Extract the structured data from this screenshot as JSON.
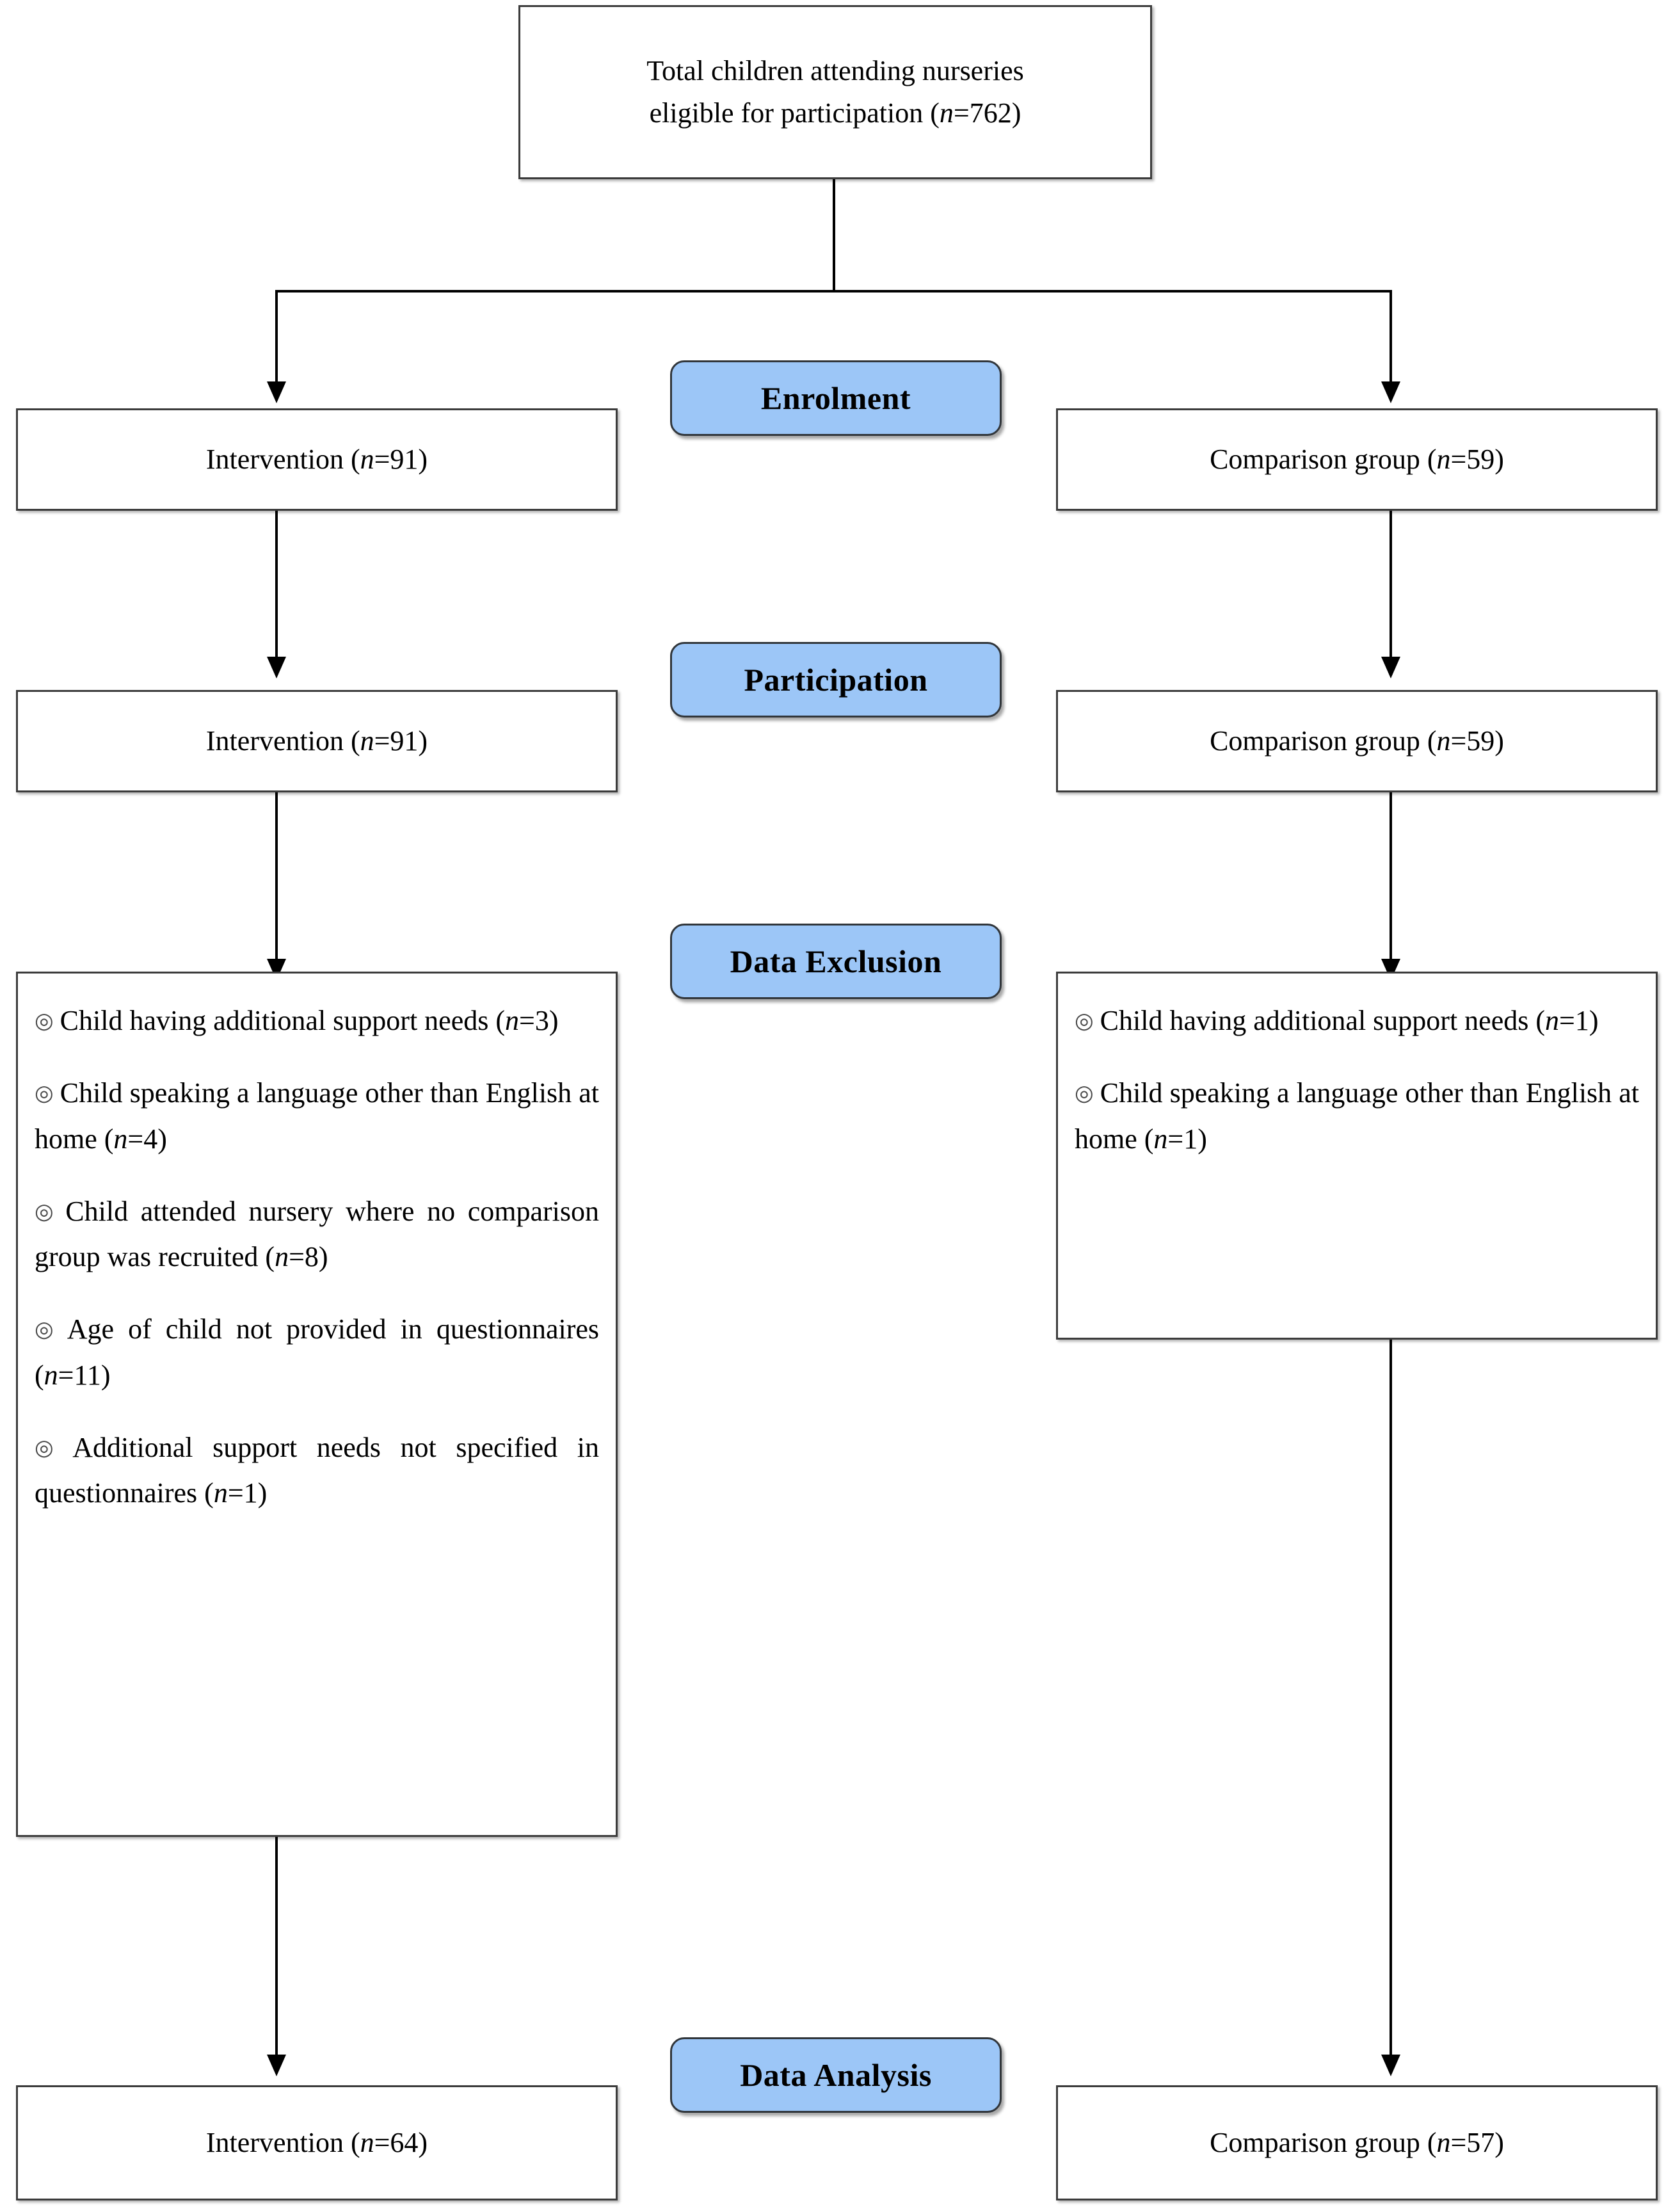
{
  "figure": {
    "type": "participant-flow-diagram",
    "accent_blue": "#9CC6F7",
    "border_color": "#3c3c3c"
  },
  "top_box": {
    "line1": "Total children attending nurseries",
    "line2_prefix": "eligible for participation (",
    "line2_italic": "n",
    "line2_suffix": "=762)"
  },
  "stages": [
    {
      "id": "enrolment",
      "label": "Enrolment"
    },
    {
      "id": "participation",
      "label": "Participation"
    },
    {
      "id": "data-exclusion",
      "label": "Data Exclusion"
    },
    {
      "id": "data-analysis",
      "label": "Data Analysis"
    }
  ],
  "enrolment": {
    "left": {
      "prefix": "Intervention (",
      "italic": "n",
      "suffix": "=91)"
    },
    "right": {
      "prefix": "Comparison group (",
      "italic": "n",
      "suffix": "=59)"
    }
  },
  "participation": {
    "left": {
      "prefix": "Intervention (",
      "italic": "n",
      "suffix": "=91)"
    },
    "right": {
      "prefix": "Comparison group (",
      "italic": "n",
      "suffix": "=59)"
    }
  },
  "exclusion_left": {
    "bullet_glyph": "◎",
    "items": [
      {
        "text_before": "Child having additional support needs (",
        "italic": "n",
        "text_after": "=3)"
      },
      {
        "text_before": "Child speaking a language other than English at home (",
        "italic": "n",
        "text_after": "=4)"
      },
      {
        "text_before": "Child attended nursery where no comparison group was recruited (",
        "italic": "n",
        "text_after": "=8)"
      },
      {
        "text_before": "Age of child not provided in questionnaires (",
        "italic": "n",
        "text_after": "=11)"
      },
      {
        "text_before": "Additional support needs not specified in questionnaires (",
        "italic": "n",
        "text_after": "=1)"
      }
    ]
  },
  "exclusion_right": {
    "bullet_glyph": "◎",
    "items": [
      {
        "text_before": "Child having additional support needs (",
        "italic": "n",
        "text_after": "=1)"
      },
      {
        "text_before": "Child speaking a language other than English at home (",
        "italic": "n",
        "text_after": "=1)"
      }
    ]
  },
  "analysis": {
    "left": {
      "prefix": "Intervention (",
      "italic": "n",
      "suffix": "=64)"
    },
    "right": {
      "prefix": "Comparison group (",
      "italic": "n",
      "suffix": "=57)"
    }
  }
}
